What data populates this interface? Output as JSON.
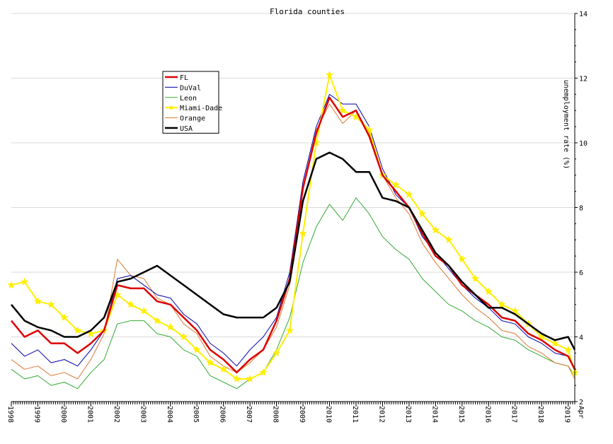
{
  "chart_data": {
    "type": "line",
    "title": "Florida counties",
    "xlabel": "",
    "ylabel": "unemployment rate (%)",
    "xlim": [
      "1998-01",
      "2019-04"
    ],
    "ylim": [
      2,
      14
    ],
    "y_ticks": [
      2,
      4,
      6,
      8,
      10,
      12,
      14
    ],
    "x_tick_labels": [
      "1998",
      "1999",
      "2000",
      "2001",
      "2002",
      "2003",
      "2004",
      "2005",
      "2006",
      "2007",
      "2008",
      "2009",
      "2010",
      "2011",
      "2012",
      "2013",
      "2014",
      "2015",
      "2016",
      "2017",
      "2018",
      "2019",
      "Apr"
    ],
    "x_tick_years": [
      1998,
      1999,
      2000,
      2001,
      2002,
      2003,
      2004,
      2005,
      2006,
      2007,
      2008,
      2009,
      2010,
      2011,
      2012,
      2013,
      2014,
      2015,
      2016,
      2017,
      2018,
      2019
    ],
    "last_tick_label": "Apr",
    "grid": true,
    "legend_position": "upper-left",
    "series": [
      {
        "name": "FL",
        "color": "#dd0000",
        "width": 2.5,
        "marker": "none",
        "x": [
          "1998-01",
          "1998-07",
          "1999-01",
          "1999-07",
          "2000-01",
          "2000-07",
          "2001-01",
          "2001-07",
          "2002-01",
          "2002-07",
          "2003-01",
          "2003-07",
          "2004-01",
          "2004-07",
          "2005-01",
          "2005-07",
          "2006-01",
          "2006-07",
          "2007-01",
          "2007-07",
          "2008-01",
          "2008-07",
          "2009-01",
          "2009-07",
          "2010-01",
          "2010-07",
          "2011-01",
          "2011-07",
          "2012-01",
          "2012-07",
          "2013-01",
          "2013-07",
          "2014-01",
          "2014-07",
          "2015-01",
          "2015-07",
          "2016-01",
          "2016-07",
          "2017-01",
          "2017-07",
          "2018-01",
          "2018-07",
          "2019-01",
          "2019-04"
        ],
        "y": [
          4.5,
          4.0,
          4.2,
          3.8,
          3.8,
          3.5,
          3.8,
          4.2,
          5.6,
          5.5,
          5.5,
          5.1,
          5.0,
          4.6,
          4.2,
          3.6,
          3.3,
          2.9,
          3.3,
          3.6,
          4.5,
          5.8,
          8.6,
          10.3,
          11.4,
          10.8,
          11.0,
          10.2,
          9.0,
          8.5,
          8.0,
          7.2,
          6.5,
          6.2,
          5.6,
          5.3,
          5.0,
          4.6,
          4.5,
          4.1,
          3.9,
          3.6,
          3.4,
          3.0
        ]
      },
      {
        "name": "DuVal",
        "color": "#0000aa",
        "width": 1,
        "marker": "none",
        "x": [
          "1998-01",
          "1998-07",
          "1999-01",
          "1999-07",
          "2000-01",
          "2000-07",
          "2001-01",
          "2001-07",
          "2002-01",
          "2002-07",
          "2003-01",
          "2003-07",
          "2004-01",
          "2004-07",
          "2005-01",
          "2005-07",
          "2006-01",
          "2006-07",
          "2007-01",
          "2007-07",
          "2008-01",
          "2008-07",
          "2009-01",
          "2009-07",
          "2010-01",
          "2010-07",
          "2011-01",
          "2011-07",
          "2012-01",
          "2012-07",
          "2013-01",
          "2013-07",
          "2014-01",
          "2014-07",
          "2015-01",
          "2015-07",
          "2016-01",
          "2016-07",
          "2017-01",
          "2017-07",
          "2018-01",
          "2018-07",
          "2019-01",
          "2019-04"
        ],
        "y": [
          3.8,
          3.4,
          3.6,
          3.2,
          3.3,
          3.1,
          3.6,
          4.2,
          5.8,
          5.9,
          5.6,
          5.3,
          5.2,
          4.7,
          4.4,
          3.8,
          3.5,
          3.1,
          3.6,
          4.0,
          4.6,
          6.0,
          8.8,
          10.5,
          11.5,
          11.2,
          11.2,
          10.5,
          9.2,
          8.4,
          8.0,
          7.1,
          6.6,
          6.1,
          5.6,
          5.2,
          4.9,
          4.5,
          4.4,
          4.0,
          3.8,
          3.5,
          3.4,
          3.0
        ]
      },
      {
        "name": "Leon",
        "color": "#33aa33",
        "width": 1,
        "marker": "none",
        "x": [
          "1998-01",
          "1998-07",
          "1999-01",
          "1999-07",
          "2000-01",
          "2000-07",
          "2001-01",
          "2001-07",
          "2002-01",
          "2002-07",
          "2003-01",
          "2003-07",
          "2004-01",
          "2004-07",
          "2005-01",
          "2005-07",
          "2006-01",
          "2006-07",
          "2007-01",
          "2007-07",
          "2008-01",
          "2008-07",
          "2009-01",
          "2009-07",
          "2010-01",
          "2010-07",
          "2011-01",
          "2011-07",
          "2012-01",
          "2012-07",
          "2013-01",
          "2013-07",
          "2014-01",
          "2014-07",
          "2015-01",
          "2015-07",
          "2016-01",
          "2016-07",
          "2017-01",
          "2017-07",
          "2018-01",
          "2018-07",
          "2019-01",
          "2019-04"
        ],
        "y": [
          3.0,
          2.7,
          2.8,
          2.5,
          2.6,
          2.4,
          2.9,
          3.3,
          4.4,
          4.5,
          4.5,
          4.1,
          4.0,
          3.6,
          3.4,
          2.8,
          2.6,
          2.4,
          2.7,
          2.9,
          3.6,
          4.6,
          6.3,
          7.4,
          8.1,
          7.6,
          8.3,
          7.8,
          7.1,
          6.7,
          6.4,
          5.8,
          5.4,
          5.0,
          4.8,
          4.5,
          4.3,
          4.0,
          3.9,
          3.6,
          3.4,
          3.2,
          3.1,
          2.8
        ]
      },
      {
        "name": "Miami-Dade",
        "color": "#ffee00",
        "width": 2,
        "marker": "star",
        "x": [
          "1998-01",
          "1998-07",
          "1999-01",
          "1999-07",
          "2000-01",
          "2000-07",
          "2001-01",
          "2001-07",
          "2002-01",
          "2002-07",
          "2003-01",
          "2003-07",
          "2004-01",
          "2004-07",
          "2005-01",
          "2005-07",
          "2006-01",
          "2006-07",
          "2007-01",
          "2007-07",
          "2008-01",
          "2008-07",
          "2009-01",
          "2009-07",
          "2010-01",
          "2010-07",
          "2011-01",
          "2011-07",
          "2012-01",
          "2012-07",
          "2013-01",
          "2013-07",
          "2014-01",
          "2014-07",
          "2015-01",
          "2015-07",
          "2016-01",
          "2016-07",
          "2017-01",
          "2017-07",
          "2018-01",
          "2018-07",
          "2019-01",
          "2019-04"
        ],
        "y": [
          5.6,
          5.7,
          5.1,
          5.0,
          4.6,
          4.2,
          4.1,
          4.2,
          5.3,
          5.0,
          4.8,
          4.5,
          4.3,
          4.0,
          3.6,
          3.2,
          3.0,
          2.7,
          2.7,
          2.9,
          3.5,
          4.2,
          7.2,
          10.0,
          12.1,
          11.0,
          10.8,
          10.4,
          9.0,
          8.7,
          8.4,
          7.8,
          7.3,
          7.0,
          6.4,
          5.8,
          5.4,
          5.0,
          4.8,
          4.4,
          4.0,
          3.8,
          3.6,
          2.9
        ]
      },
      {
        "name": "Orange",
        "color": "#dd7733",
        "width": 1,
        "marker": "none",
        "x": [
          "1998-01",
          "1998-07",
          "1999-01",
          "1999-07",
          "2000-01",
          "2000-07",
          "2001-01",
          "2001-07",
          "2002-01",
          "2002-07",
          "2003-01",
          "2003-07",
          "2004-01",
          "2004-07",
          "2005-01",
          "2005-07",
          "2006-01",
          "2006-07",
          "2007-01",
          "2007-07",
          "2008-01",
          "2008-07",
          "2009-01",
          "2009-07",
          "2010-01",
          "2010-07",
          "2011-01",
          "2011-07",
          "2012-01",
          "2012-07",
          "2013-01",
          "2013-07",
          "2014-01",
          "2014-07",
          "2015-01",
          "2015-07",
          "2016-01",
          "2016-07",
          "2017-01",
          "2017-07",
          "2018-01",
          "2018-07",
          "2019-01",
          "2019-04"
        ],
        "y": [
          3.3,
          3.0,
          3.1,
          2.8,
          2.9,
          2.7,
          3.3,
          4.1,
          6.4,
          5.9,
          5.8,
          5.2,
          5.0,
          4.4,
          4.1,
          3.4,
          3.1,
          2.9,
          3.2,
          3.6,
          4.3,
          5.6,
          8.6,
          10.4,
          11.2,
          10.6,
          11.0,
          10.3,
          9.0,
          8.3,
          7.8,
          6.9,
          6.3,
          5.8,
          5.3,
          4.9,
          4.6,
          4.2,
          4.1,
          3.7,
          3.5,
          3.2,
          3.1,
          2.7
        ]
      },
      {
        "name": "USA",
        "color": "#000000",
        "width": 2.5,
        "marker": "none",
        "x": [
          "1998-01",
          "1998-07",
          "1999-01",
          "1999-07",
          "2000-01",
          "2000-07",
          "2001-01",
          "2001-07",
          "2002-01",
          "2002-07",
          "2003-01",
          "2003-07",
          "2004-01",
          "2004-07",
          "2005-01",
          "2005-07",
          "2006-01",
          "2006-07",
          "2007-01",
          "2007-07",
          "2008-01",
          "2008-07",
          "2009-01",
          "2009-07",
          "2010-01",
          "2010-07",
          "2011-01",
          "2011-07",
          "2012-01",
          "2012-07",
          "2013-01",
          "2013-07",
          "2014-01",
          "2014-07",
          "2015-01",
          "2015-07",
          "2016-01",
          "2016-07",
          "2017-01",
          "2017-07",
          "2018-01",
          "2018-07",
          "2019-01",
          "2019-04"
        ],
        "y": [
          5.0,
          4.5,
          4.3,
          4.2,
          4.0,
          4.0,
          4.2,
          4.6,
          5.7,
          5.8,
          6.0,
          6.2,
          5.9,
          5.6,
          5.3,
          5.0,
          4.7,
          4.6,
          4.6,
          4.6,
          4.9,
          5.7,
          8.2,
          9.5,
          9.7,
          9.5,
          9.1,
          9.1,
          8.3,
          8.2,
          8.0,
          7.3,
          6.6,
          6.2,
          5.7,
          5.3,
          4.9,
          4.9,
          4.7,
          4.4,
          4.1,
          3.9,
          4.0,
          3.6
        ]
      }
    ]
  }
}
